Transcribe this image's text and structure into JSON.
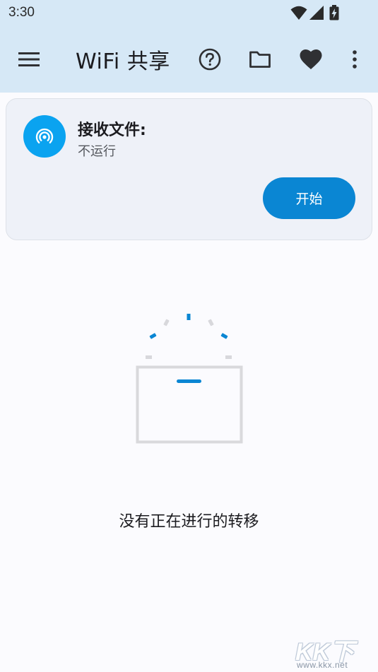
{
  "status_bar": {
    "time": "3:30",
    "icons": [
      "wifi-icon",
      "cell-signal-icon",
      "battery-charging-icon"
    ]
  },
  "app_bar": {
    "title": "WiFi 共享",
    "actions": [
      "menu-icon",
      "help-icon",
      "folder-icon",
      "heart-icon",
      "more-vert-icon"
    ]
  },
  "receive_card": {
    "icon": "broadcast-icon",
    "title": "接收文件:",
    "status": "不运行",
    "button_label": "开始"
  },
  "empty_state": {
    "illustration": "empty-transfer-box-illustration",
    "message": "没有正在进行的转移"
  },
  "watermark": {
    "logo_text": "KK下载",
    "url": "www.kkx.net"
  },
  "colors": {
    "app_bar_bg": "#d6e8f6",
    "accent": "#0a86d3",
    "avatar": "#0aa3f0",
    "card_bg": "#eef1f8",
    "page_bg": "#fbfbfe"
  }
}
